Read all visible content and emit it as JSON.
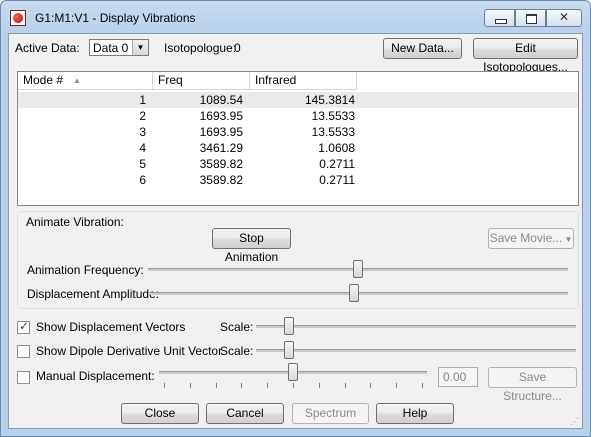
{
  "window": {
    "title": "G1:M1:V1 - Display Vibrations"
  },
  "top": {
    "active_data_label": "Active Data:",
    "active_data_value": "Data 0",
    "isotopologue_label": "Isotopologue:",
    "isotopologue_value": "0",
    "new_data_button": "New Data...",
    "edit_isotopologues_button": "Edit Isotopologues..."
  },
  "table": {
    "columns": [
      "Mode #",
      "Freq",
      "Infrared"
    ],
    "rows": [
      {
        "mode": "1",
        "freq": "1089.54",
        "ir": "145.3814"
      },
      {
        "mode": "2",
        "freq": "1693.95",
        "ir": "13.5533"
      },
      {
        "mode": "3",
        "freq": "1693.95",
        "ir": "13.5533"
      },
      {
        "mode": "4",
        "freq": "3461.29",
        "ir": "1.0608"
      },
      {
        "mode": "5",
        "freq": "3589.82",
        "ir": "0.2711"
      },
      {
        "mode": "6",
        "freq": "3589.82",
        "ir": "0.2711"
      }
    ]
  },
  "animate": {
    "group_label": "Animate Vibration:",
    "stop_button": "Stop Animation",
    "save_movie_button": "Save Movie...",
    "frequency_label": "Animation Frequency:",
    "frequency_level": 0.5,
    "amplitude_label": "Displacement Amplitude:",
    "amplitude_level": 0.49
  },
  "options": {
    "show_vectors_label": "Show Displacement Vectors",
    "show_vectors_checked": true,
    "show_vectors_scale_label": "Scale:",
    "show_vectors_scale_level": 0.09,
    "dipole_label": "Show Dipole Derivative Unit Vector",
    "dipole_checked": false,
    "dipole_scale_label": "Scale:",
    "dipole_scale_level": 0.09,
    "manual_label": "Manual Displacement:",
    "manual_checked": false,
    "manual_level": 0.5,
    "manual_value": "0.00",
    "save_structure_button": "Save Structure..."
  },
  "footer": {
    "close_button": "Close",
    "cancel_button": "Cancel",
    "spectrum_button": "Spectrum",
    "help_button": "Help"
  }
}
